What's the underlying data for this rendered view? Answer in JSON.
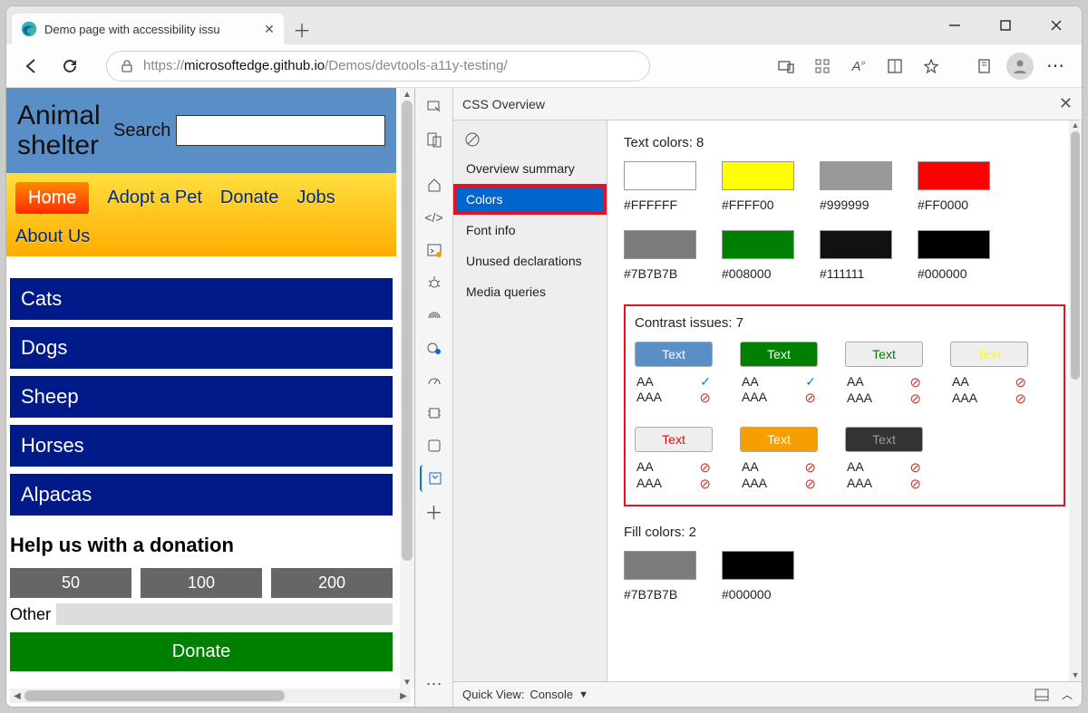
{
  "window": {
    "tab_title": "Demo page with accessibility issu",
    "url_proto": "https://",
    "url_host": "microsoftedge.github.io",
    "url_path": "/Demos/devtools-a11y-testing/"
  },
  "page": {
    "site_title": "Animal shelter",
    "search_label": "Search",
    "nav": [
      "Home",
      "Adopt a Pet",
      "Donate",
      "Jobs",
      "About Us"
    ],
    "animals": [
      "Cats",
      "Dogs",
      "Sheep",
      "Horses",
      "Alpacas"
    ],
    "donation_heading": "Help us with a donation",
    "amounts": [
      "50",
      "100",
      "200"
    ],
    "other_label": "Other",
    "donate_button": "Donate"
  },
  "devtools": {
    "panel_title": "CSS Overview",
    "sidebar": [
      "Overview summary",
      "Colors",
      "Font info",
      "Unused declarations",
      "Media queries"
    ],
    "sidebar_selected": "Colors",
    "text_colors_label": "Text colors: 8",
    "text_colors": [
      {
        "hex": "#FFFFFF",
        "bg": "#FFFFFF"
      },
      {
        "hex": "#FFFF00",
        "bg": "#FFFF00"
      },
      {
        "hex": "#999999",
        "bg": "#999999"
      },
      {
        "hex": "#FF0000",
        "bg": "#FF0000"
      },
      {
        "hex": "#7B7B7B",
        "bg": "#7B7B7B"
      },
      {
        "hex": "#008000",
        "bg": "#008000"
      },
      {
        "hex": "#111111",
        "bg": "#111111"
      },
      {
        "hex": "#000000",
        "bg": "#000000"
      }
    ],
    "contrast_label": "Contrast issues: 7",
    "contrast": [
      {
        "fg": "#FFFFFF",
        "bg": "#5a8ec6",
        "aa": "ok",
        "aaa": "bad"
      },
      {
        "fg": "#FFFFFF",
        "bg": "#008000",
        "aa": "ok",
        "aaa": "bad"
      },
      {
        "fg": "#008000",
        "bg": "#eeeeee",
        "aa": "bad",
        "aaa": "bad"
      },
      {
        "fg": "#FFFF00",
        "bg": "#eeeeee",
        "aa": "bad",
        "aaa": "bad"
      },
      {
        "fg": "#FF0000",
        "bg": "#eeeeee",
        "aa": "bad",
        "aaa": "bad"
      },
      {
        "fg": "#FFFFFF",
        "bg": "#f5a000",
        "aa": "bad",
        "aaa": "bad"
      },
      {
        "fg": "#999999",
        "bg": "#333333",
        "aa": "bad",
        "aaa": "bad"
      }
    ],
    "pill_text": "Text",
    "aa_label": "AA",
    "aaa_label": "AAA",
    "fill_colors_label": "Fill colors: 2",
    "fill_colors": [
      {
        "hex": "#7B7B7B",
        "bg": "#7B7B7B"
      },
      {
        "hex": "#000000",
        "bg": "#000000"
      }
    ],
    "footer_quick": "Quick View:",
    "footer_console": "Console"
  }
}
